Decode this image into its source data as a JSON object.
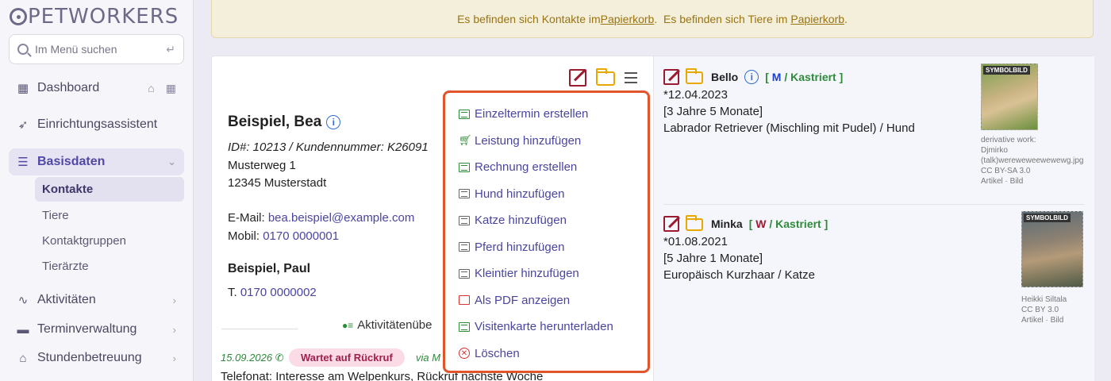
{
  "brand": {
    "name": "PETWORKERS"
  },
  "search": {
    "placeholder": "Im Menü suchen"
  },
  "sidebar": {
    "items": [
      {
        "label": "Dashboard"
      },
      {
        "label": "Einrichtungsassistent"
      },
      {
        "label": "Basisdaten"
      },
      {
        "label": "Aktivitäten"
      },
      {
        "label": "Terminverwaltung"
      },
      {
        "label": "Stundenbetreuung"
      }
    ],
    "sub_items": [
      {
        "label": "Kontakte"
      },
      {
        "label": "Tiere"
      },
      {
        "label": "Kontaktgruppen"
      },
      {
        "label": "Tierärzte"
      }
    ]
  },
  "notice": {
    "text1": "Es befinden sich Kontakte im ",
    "link1": "Papierkorb",
    "text2": ".  Es befinden sich Tiere im ",
    "link2": "Papierkorb",
    "text3": "."
  },
  "contact": {
    "name": "Beispiel, Bea",
    "ids": "ID#: 10213 / Kundennummer: K26091",
    "street": "Musterweg 1",
    "city": "12345 Musterstadt",
    "email_label": "E-Mail: ",
    "email": "bea.beispiel@example.com",
    "mobile_label": "Mobil: ",
    "mobile": "0170 0000001",
    "second_name": "Beispiel, Paul",
    "phone_label": "T. ",
    "phone": "0170 0000002"
  },
  "activities": {
    "heading": "Aktivitätenübe",
    "date": "15.09.2026",
    "status": "Wartet auf Rückruf",
    "via": "via M",
    "text": "Telefonat: Interesse am Welpenkurs, Rückruf nächste Woche"
  },
  "dropdown": {
    "items": [
      {
        "label": "Einzeltermin erstellen"
      },
      {
        "label": "Leistung hinzufügen"
      },
      {
        "label": "Rechnung erstellen"
      },
      {
        "label": "Hund hinzufügen"
      },
      {
        "label": "Katze hinzufügen"
      },
      {
        "label": "Pferd hinzufügen"
      },
      {
        "label": "Kleintier hinzufügen"
      },
      {
        "label": "Als PDF anzeigen"
      },
      {
        "label": "Visitenkarte herunterladen"
      },
      {
        "label": "Löschen"
      }
    ]
  },
  "pets": [
    {
      "name": "Bello",
      "sex": "M",
      "neutered": "Kastriert",
      "birth": "*12.04.2023",
      "age": "[3 Jahre 5 Monate]",
      "breed": "Labrador Retriever (Mischling mit Pudel) / Hund",
      "photo_tag": "SYMBOLBILD",
      "credit_lines": [
        "derivative work:",
        "Djmirko",
        "(talk)wereweweewewewg.jpg",
        "CC BY-SA 3.0"
      ],
      "credit_links": "Artikel · Bild"
    },
    {
      "name": "Minka",
      "sex": "W",
      "neutered": "Kastriert",
      "birth": "*01.08.2021",
      "age": "[5 Jahre 1 Monate]",
      "breed": "Europäisch Kurzhaar / Katze",
      "photo_tag": "SYMBOLBILD",
      "credit_lines": [
        "Heikki Siltala",
        "CC BY 3.0"
      ],
      "credit_links": "Artikel · Bild"
    }
  ],
  "colors": {
    "accent": "#4a45a0",
    "dropdown_border": "#e2552c",
    "green": "#2e8b3a",
    "male": "#1b3fc7",
    "female": "#9b1b30"
  }
}
